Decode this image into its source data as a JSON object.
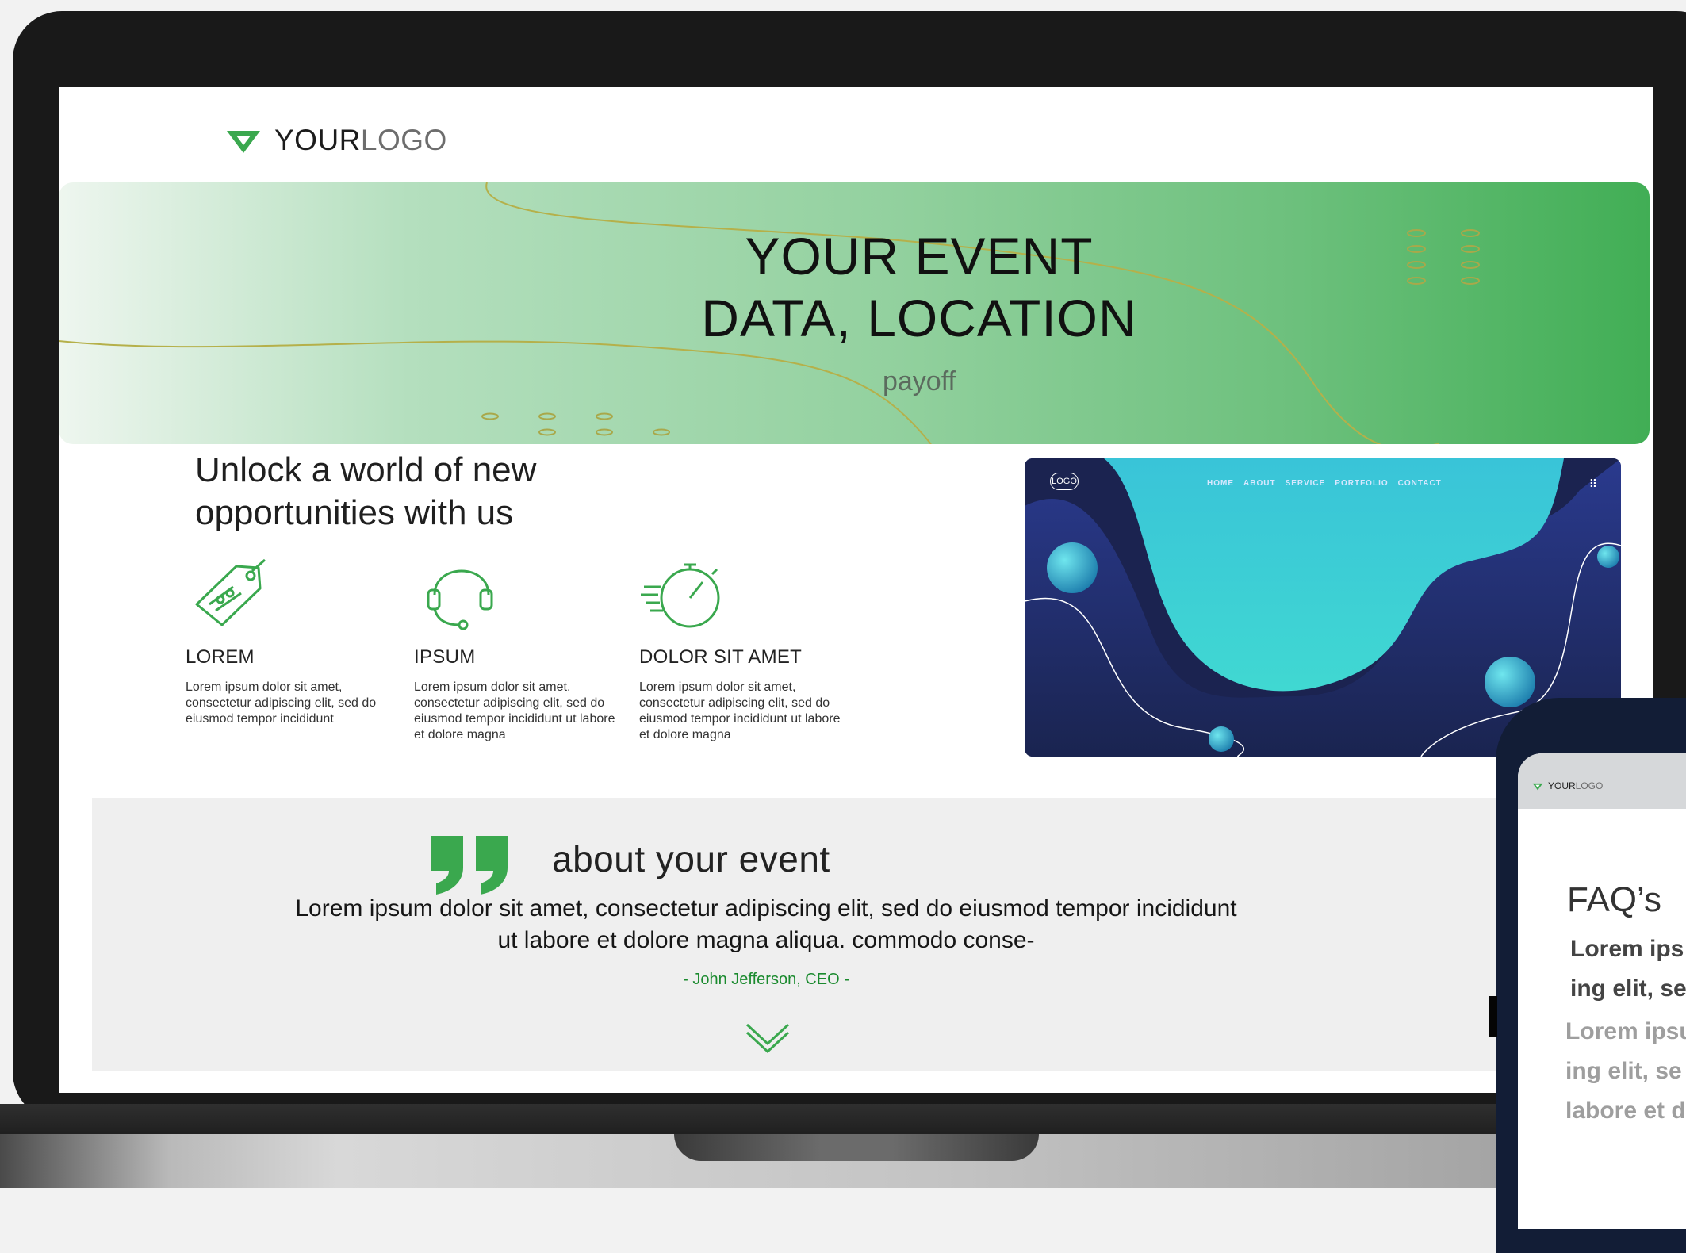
{
  "header": {
    "logo_bold": "YOUR",
    "logo_light": "LOGO"
  },
  "hero": {
    "title_line1": "YOUR EVENT",
    "title_line2": "DATA, LOCATION",
    "payoff": "payoff"
  },
  "features_section": {
    "title": "Unlock a world of new opportunities with us",
    "items": [
      {
        "icon": "price-tag-icon",
        "title": "LOREM",
        "text": "Lorem ipsum dolor sit amet, consectetur adipiscing elit, sed do eiusmod tempor incididunt"
      },
      {
        "icon": "headset-icon",
        "title": "IPSUM",
        "text": "Lorem ipsum dolor sit amet, consectetur adipiscing elit, sed do eiusmod tempor incididunt ut labore et dolore magna"
      },
      {
        "icon": "stopwatch-icon",
        "title": "DOLOR SIT AMET",
        "text": "Lorem ipsum dolor sit amet, consectetur adipiscing elit, sed do eiusmod tempor incididunt ut labore et dolore magna"
      }
    ]
  },
  "preview": {
    "logo": "LOGO",
    "nav": [
      "HOME",
      "ABOUT",
      "SERVICE",
      "PORTFOLIO",
      "CONTACT"
    ],
    "menu_icon": "grid-menu-icon"
  },
  "testimonial": {
    "heading": "about your event",
    "body": "Lorem ipsum dolor sit amet, consectetur adipiscing elit, sed do eiusmod tempor incididunt ut labore et dolore magna aliqua. commodo conse-",
    "author": "- John Jefferson, CEO -",
    "chevron_icon": "chevron-down-icon"
  },
  "phone": {
    "logo_bold": "YOUR",
    "logo_light": "LOGO",
    "faq_title": "FAQ’s",
    "question": "Lorem ips\ning elit, se",
    "answer": "Lorem ipsu\ning elit, se\nlabore et d"
  },
  "colors": {
    "brand_green": "#3aa84e",
    "author_green": "#1a8a2e",
    "testimonial_bg": "#efefef",
    "preview_navy": "#1c2350",
    "preview_teal": "#3fd2d2"
  }
}
